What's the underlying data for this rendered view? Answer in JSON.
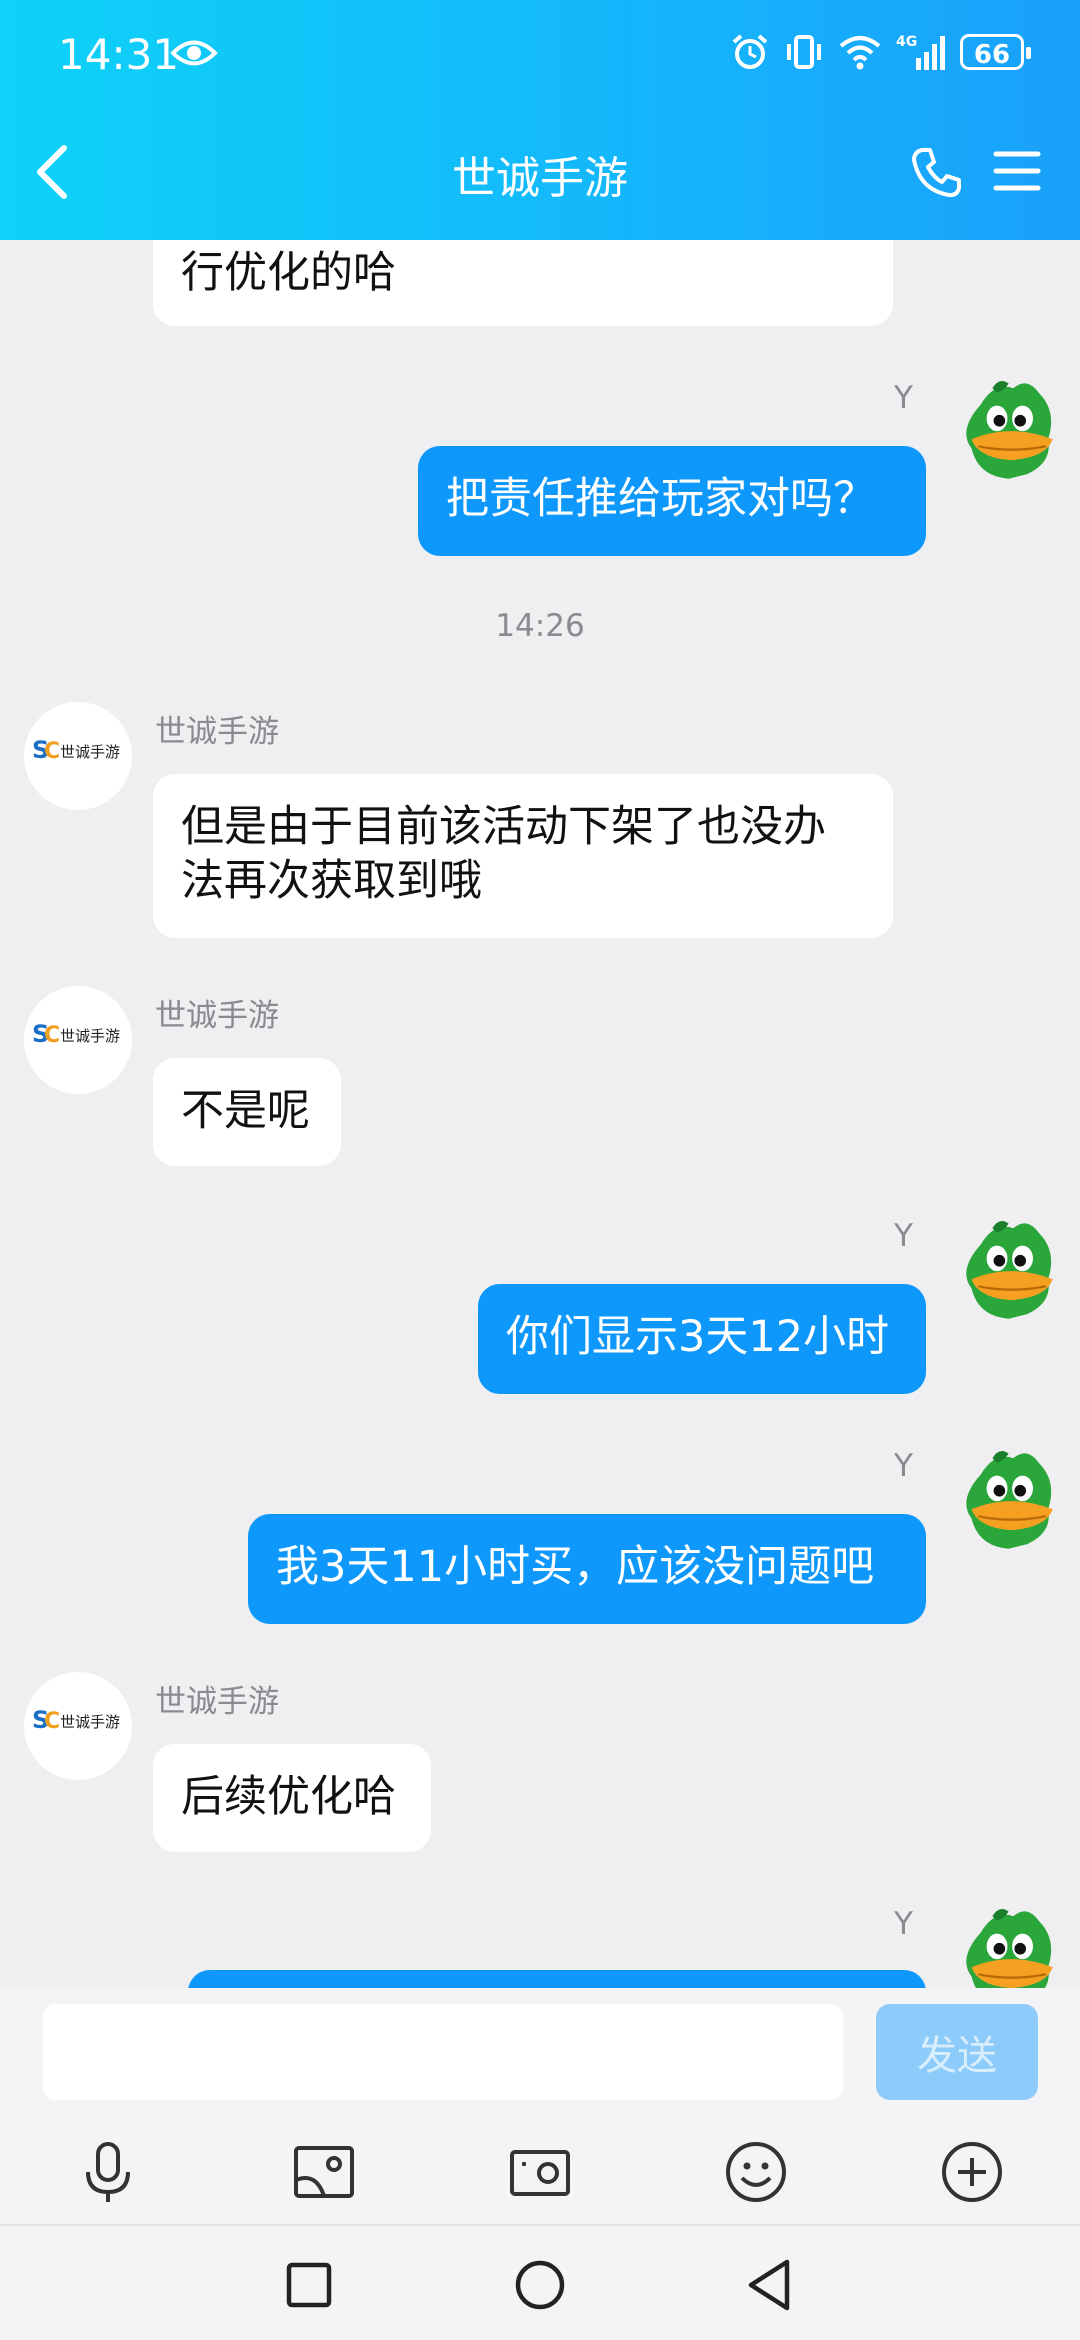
{
  "status_bar": {
    "time": "14:31",
    "battery": "66",
    "network": "4G"
  },
  "header": {
    "title": "世诚手游"
  },
  "messages": [
    {
      "text": "行优化的哈"
    },
    {
      "sender": "Y",
      "text": "把责任推给玩家对吗？"
    },
    {
      "timestamp": "14:26"
    },
    {
      "sender": "世诚手游",
      "text": "但是由于目前该活动下架了也没办\n法再次获取到哦"
    },
    {
      "sender": "世诚手游",
      "text": "不是呢"
    },
    {
      "sender": "Y",
      "text": "你们显示3天12小时"
    },
    {
      "sender": "Y",
      "text": "我3天11小时买，应该没问题吧"
    },
    {
      "sender": "世诚手游",
      "text": "后续优化哈"
    },
    {
      "sender": "Y",
      "text": ""
    }
  ],
  "input": {
    "value": "",
    "placeholder": "",
    "send_label": "发送"
  },
  "toolbar": [
    "microphone-icon",
    "image-icon",
    "camera-icon",
    "emoji-icon",
    "plus-icon"
  ],
  "colors": {
    "header_start": "#0ed2f7",
    "header_end": "#1aa0fb",
    "outgoing_bubble": "#0e98fb",
    "incoming_bubble": "#ffffff",
    "send_disabled": "#8dcbfb"
  }
}
